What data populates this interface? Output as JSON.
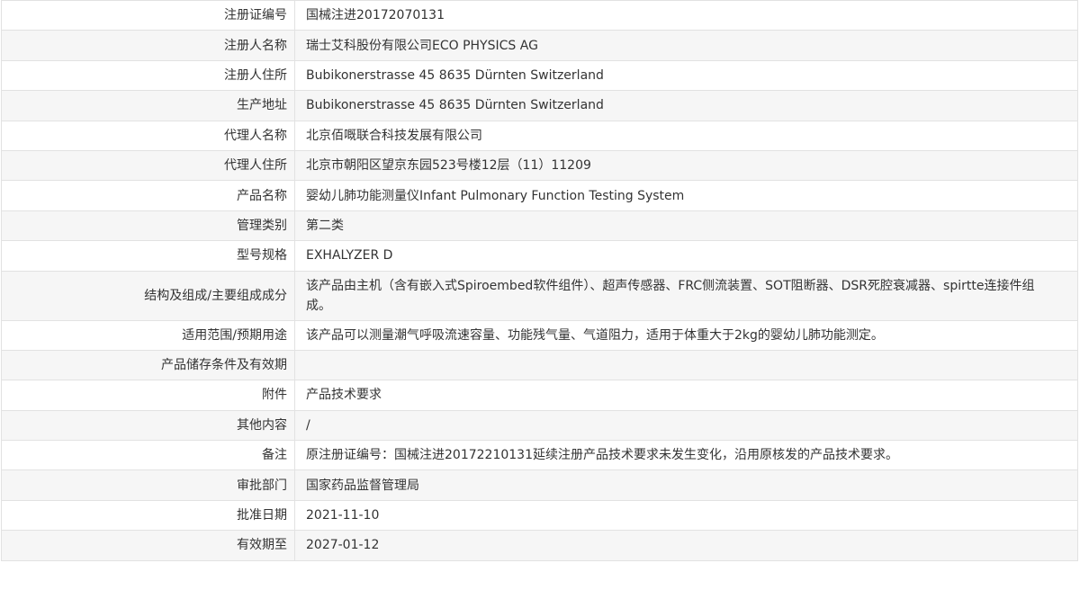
{
  "rows": [
    {
      "label": "注册证编号",
      "value": "国械注进20172070131"
    },
    {
      "label": "注册人名称",
      "value": "瑞士艾科股份有限公司ECO PHYSICS AG"
    },
    {
      "label": "注册人住所",
      "value": "Bubikonerstrasse 45 8635 Dürnten Switzerland"
    },
    {
      "label": "生产地址",
      "value": "Bubikonerstrasse 45 8635 Dürnten Switzerland"
    },
    {
      "label": "代理人名称",
      "value": "北京佰嘅联合科技发展有限公司"
    },
    {
      "label": "代理人住所",
      "value": "北京市朝阳区望京东园523号楼12层（11）11209"
    },
    {
      "label": "产品名称",
      "value": "婴幼儿肺功能测量仪Infant Pulmonary Function Testing System"
    },
    {
      "label": "管理类别",
      "value": "第二类"
    },
    {
      "label": "型号规格",
      "value": "EXHALYZER D"
    },
    {
      "label": "结构及组成/主要组成成分",
      "value": "该产品由主机（含有嵌入式Spiroembed软件组件）、超声传感器、FRC侧流装置、SOT阻断器、DSR死腔衰减器、spirtte连接件组成。"
    },
    {
      "label": "适用范围/预期用途",
      "value": "该产品可以测量潮气呼吸流速容量、功能残气量、气道阻力，适用于体重大于2kg的婴幼儿肺功能测定。"
    },
    {
      "label": "产品储存条件及有效期",
      "value": ""
    },
    {
      "label": "附件",
      "value": "产品技术要求"
    },
    {
      "label": "其他内容",
      "value": "/"
    },
    {
      "label": "备注",
      "value": "原注册证编号：国械注进20172210131延续注册产品技术要求未发生变化，沿用原核发的产品技术要求。"
    },
    {
      "label": "审批部门",
      "value": "国家药品监督管理局"
    },
    {
      "label": "批准日期",
      "value": "2021-11-10"
    },
    {
      "label": "有效期至",
      "value": "2027-01-12"
    }
  ]
}
